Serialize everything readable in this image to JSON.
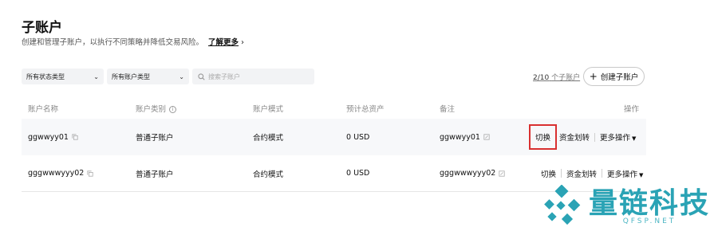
{
  "header": {
    "title": "子账户",
    "subtitle": "创建和管理子账户，以执行不同策略并降低交易风险。",
    "learn_more": "了解更多"
  },
  "filters": {
    "status": "所有状态类型",
    "account_type": "所有账户类型",
    "search_placeholder": "搜索子账户"
  },
  "summary": {
    "count": "2/10",
    "count_suffix": "个子账户",
    "create_label": "创建子账户"
  },
  "table": {
    "columns": [
      "账户名称",
      "账户类别",
      "账户模式",
      "预计总资产",
      "备注",
      "操作"
    ],
    "rows": [
      {
        "name": "ggwwyy01",
        "type": "普通子账户",
        "mode": "合约模式",
        "assets": "0 USD",
        "note": "ggwwyy01"
      },
      {
        "name": "gggwwwyyy02",
        "type": "普通子账户",
        "mode": "合约模式",
        "assets": "0 USD",
        "note": "gggwwwyyy02"
      }
    ],
    "actions": {
      "switch": "切换",
      "transfer": "资金划转",
      "more": "更多操作"
    }
  },
  "watermark": {
    "cn": "量链科技",
    "en": "QFSP.NET"
  },
  "colors": {
    "highlight_border": "#d93030",
    "watermark": "#2aa3b5"
  }
}
